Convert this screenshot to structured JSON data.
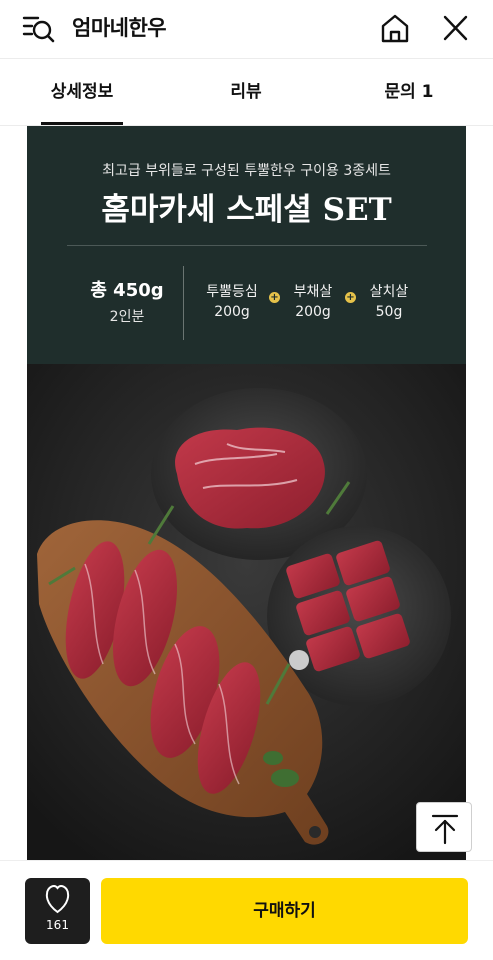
{
  "header": {
    "store_name": "엄마네한우",
    "icons": {
      "menu": "menu-search-icon",
      "home": "home-icon",
      "close": "close-icon"
    }
  },
  "tabs": [
    {
      "label": "상세정보",
      "active": true
    },
    {
      "label": "리뷰",
      "active": false
    },
    {
      "label": "문의 1",
      "active": false
    }
  ],
  "product": {
    "subtitle": "최고급 부위들로 구성된 투뿔한우 구이용 3종세트",
    "title": "홈마카세 스페셜 SET",
    "total_weight": "총 450g",
    "servings": "2인분",
    "cuts": [
      {
        "name": "투뿔등심",
        "weight": "200g"
      },
      {
        "name": "부채살",
        "weight": "200g"
      },
      {
        "name": "살치살",
        "weight": "50g"
      }
    ],
    "plus_symbol": "+"
  },
  "photo": {
    "description_icon": "beef-product-photo"
  },
  "footer": {
    "like_count": "161",
    "like_icon": "heart-icon",
    "buy_label": "구매하기",
    "scroll_top_icon": "arrow-up-to-top-icon"
  },
  "colors": {
    "panel_bg": "#1f2e2c",
    "buy_button": "#ffd900",
    "like_button": "#1e1e1e",
    "accent_plus": "#e6c24a"
  }
}
